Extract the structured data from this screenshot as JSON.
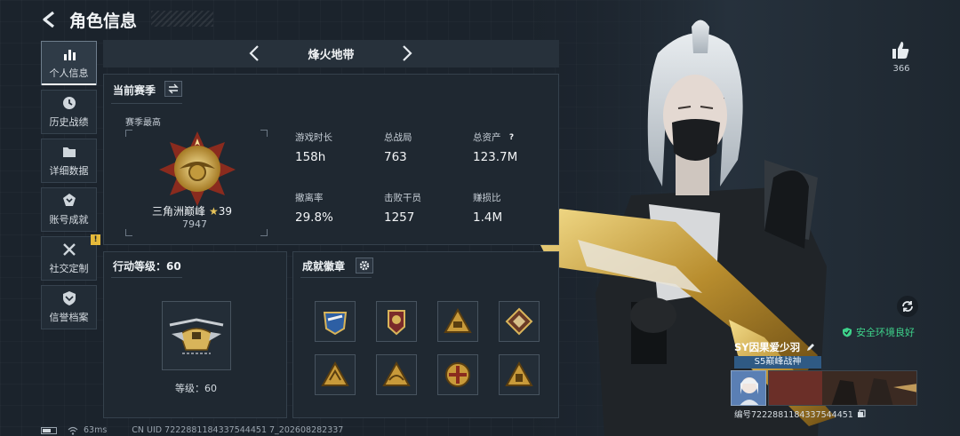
{
  "header": {
    "title": "角色信息"
  },
  "sidebar": {
    "items": [
      {
        "label": "个人信息",
        "icon": "bar-chart-icon",
        "active": true
      },
      {
        "label": "历史战绩",
        "icon": "clock-icon"
      },
      {
        "label": "详细数据",
        "icon": "folder-icon"
      },
      {
        "label": "账号成就",
        "icon": "medal-icon"
      },
      {
        "label": "社交定制",
        "icon": "tools-icon",
        "badge": "!"
      },
      {
        "label": "信誉档案",
        "icon": "shield-icon"
      }
    ]
  },
  "mode": {
    "title": "烽火地带"
  },
  "season": {
    "title": "当前赛季",
    "best_label": "赛季最高",
    "rank_name": "三角洲巅峰",
    "rank_star": "★",
    "rank_level": "39",
    "rank_score": "7947",
    "stats": [
      {
        "label": "游戏时长",
        "value": "158h"
      },
      {
        "label": "总战局",
        "value": "763"
      },
      {
        "label": "总资产",
        "value": "123.7M",
        "help": "?"
      },
      {
        "label": "撤离率",
        "value": "29.8%"
      },
      {
        "label": "击败干员",
        "value": "1257"
      },
      {
        "label": "赚损比",
        "value": "1.4M"
      }
    ]
  },
  "level": {
    "title": "行动等级：60",
    "text": "等级：60"
  },
  "achievements": {
    "title": "成就徽章",
    "count": 8
  },
  "profile": {
    "likes": "366",
    "safe_status": "安全环境良好",
    "player_name": "SY因果爱少羽",
    "player_title": "S5巅峰战神",
    "player_id": "编号7222881184337544451"
  },
  "footer": {
    "ping": "63ms",
    "uid": "CN UID 7222881184337544451 7_202608282337"
  },
  "colors": {
    "accent_gold": "#e7c45a",
    "safe_green": "#3ed38b",
    "title_blue": "#2f5a84"
  }
}
